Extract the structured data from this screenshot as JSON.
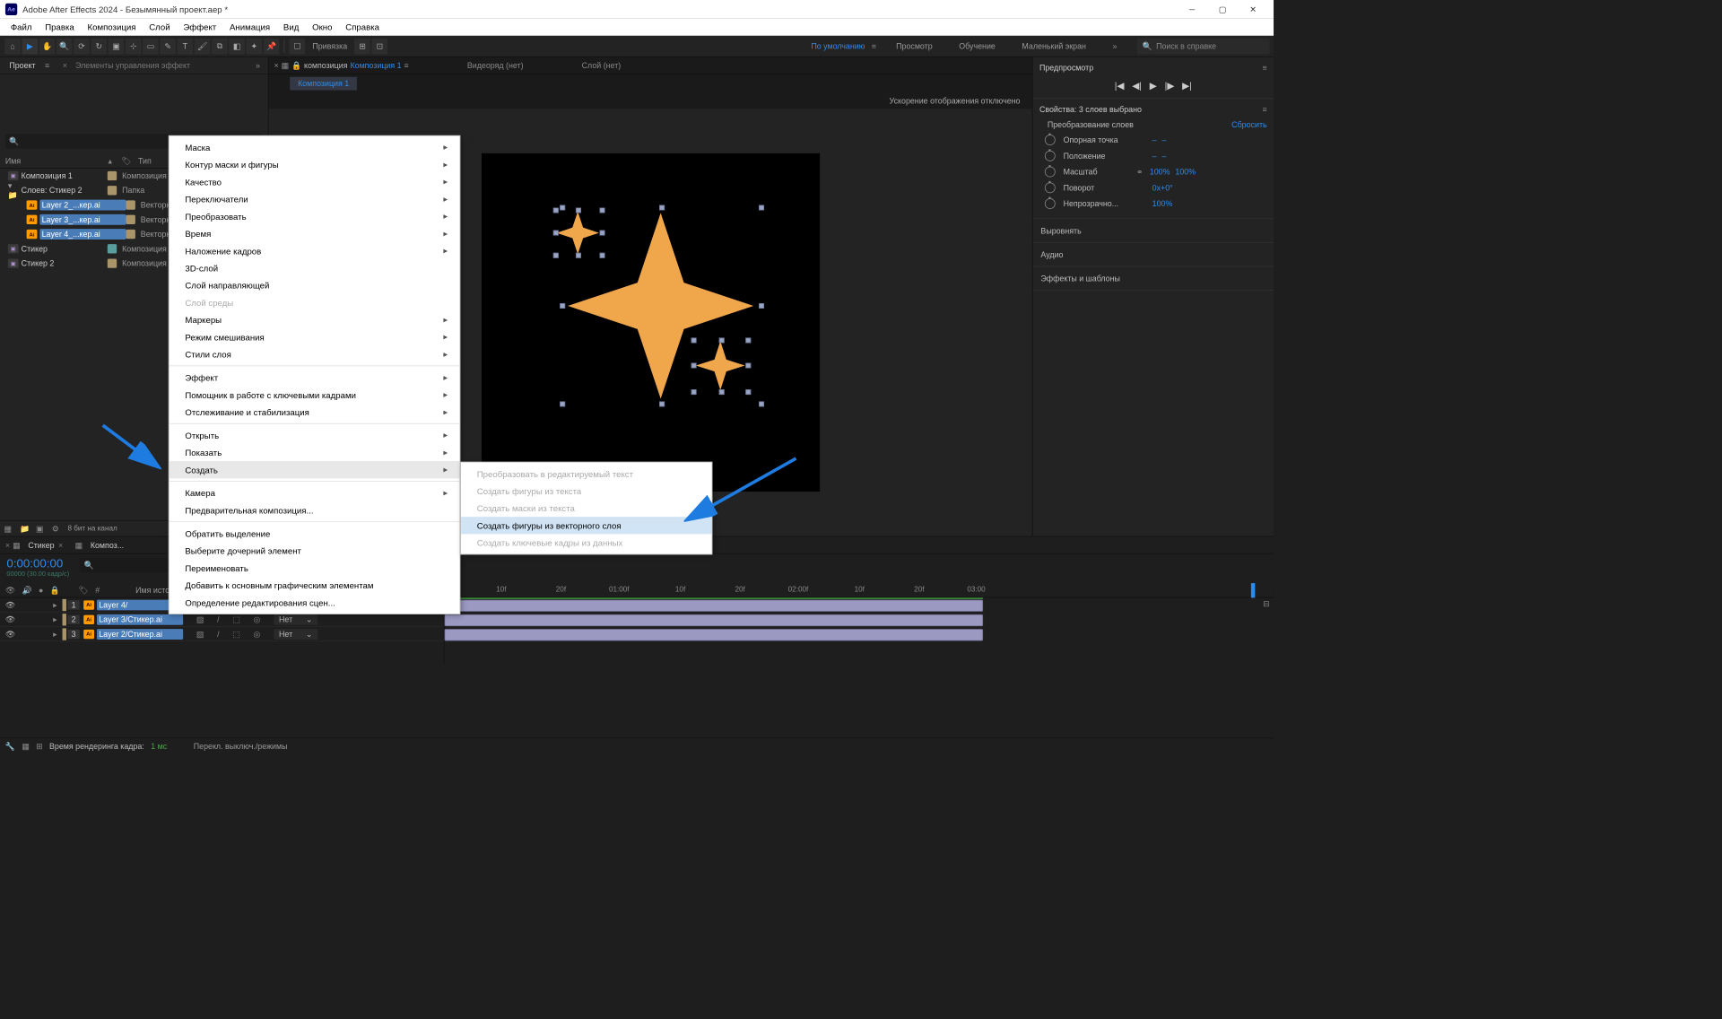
{
  "titlebar": {
    "app_icon": "Ae",
    "title": "Adobe After Effects 2024 - Безымянный проект.aep *"
  },
  "menubar": [
    "Файл",
    "Правка",
    "Композиция",
    "Слой",
    "Эффект",
    "Анимация",
    "Вид",
    "Окно",
    "Справка"
  ],
  "toolbar": {
    "snapping": "Привязка",
    "workspaces": [
      "По умолчанию",
      "Просмотр",
      "Обучение",
      "Маленький экран"
    ],
    "search_placeholder": "Поиск в справке"
  },
  "left_panel": {
    "tabs": {
      "project": "Проект",
      "effect_controls": "Элементы управления эффект"
    },
    "headers": {
      "name": "Имя",
      "type": "Тип"
    },
    "items": [
      {
        "kind": "comp",
        "name": "Композиция 1",
        "type": "Композиция",
        "indent": 0,
        "tag": "gold",
        "selected": false
      },
      {
        "kind": "folder",
        "name": "Слоев: Стикер 2",
        "type": "Папка",
        "indent": 0,
        "tag": "gold",
        "expanded": true,
        "selected": false
      },
      {
        "kind": "ai",
        "name": "Layer 2_...кер.ai",
        "type": "Векторн...",
        "indent": 2,
        "tag": "gold",
        "selected": true
      },
      {
        "kind": "ai",
        "name": "Layer 3_...кер.ai",
        "type": "Векторн...",
        "indent": 2,
        "tag": "gold",
        "selected": true
      },
      {
        "kind": "ai",
        "name": "Layer 4_...кер.ai",
        "type": "Векторн...",
        "indent": 2,
        "tag": "gold",
        "selected": true
      },
      {
        "kind": "comp",
        "name": "Стикер",
        "type": "Композиция",
        "indent": 0,
        "tag": "teal",
        "selected": false
      },
      {
        "kind": "comp",
        "name": "Стикер 2",
        "type": "Композиция",
        "indent": 0,
        "tag": "gold",
        "selected": false
      }
    ],
    "bpc": "8 бит на канал"
  },
  "center": {
    "tabs": {
      "comp_label": "композиция",
      "comp_name": "Композиция 1",
      "video": "Видеоряд  (нет)",
      "layer": "Слой (нет)"
    },
    "active_tab": "Композиция 1",
    "gpu_msg": "Ускорение отображения отключено"
  },
  "right": {
    "preview_title": "Предпросмотр",
    "props_title": "Свойства: 3 слоев выбрано",
    "transform": "Преобразование слоев",
    "reset": "Сбросить",
    "props": [
      {
        "name": "Опорная точка",
        "vals": [
          "–",
          "–"
        ]
      },
      {
        "name": "Положение",
        "vals": [
          "–",
          "–"
        ]
      },
      {
        "name": "Масштаб",
        "vals": [
          "100%",
          "100%"
        ],
        "link": true
      },
      {
        "name": "Поворот",
        "vals": [
          "0x+0°"
        ]
      },
      {
        "name": "Непрозрачно...",
        "vals": [
          "100%"
        ]
      }
    ],
    "panels": [
      "Выровнять",
      "Аудио",
      "Эффекты и шаблоны"
    ]
  },
  "timeline": {
    "tabs": [
      "Стикер",
      "Композ..."
    ],
    "timecode": "0:00:00:00",
    "fps": "00000 (30.00 кадр/с)",
    "source_col": "Имя источни...",
    "layers": [
      {
        "num": "1",
        "name": "Layer 4/",
        "color": "gold",
        "selected": true
      },
      {
        "num": "2",
        "name": "Layer 3/Стикер.ai",
        "color": "gold",
        "selected": true,
        "parent": "Нет"
      },
      {
        "num": "3",
        "name": "Layer 2/Стикер.ai",
        "color": "gold",
        "selected": true,
        "parent": "Нет"
      }
    ],
    "ruler": [
      "10f",
      "20f",
      "01:00f",
      "10f",
      "20f",
      "02:00f",
      "10f",
      "20f",
      "03:00"
    ],
    "footer": {
      "render_label": "Время рендеринга кадра:",
      "render_ms": "1 мс",
      "toggle": "Перекл. выключ./режимы"
    }
  },
  "context_menu": {
    "main": [
      {
        "label": "Маска",
        "arrow": true
      },
      {
        "label": "Контур маски и фигуры",
        "arrow": true
      },
      {
        "label": "Качество",
        "arrow": true
      },
      {
        "label": "Переключатели",
        "arrow": true
      },
      {
        "label": "Преобразовать",
        "arrow": true
      },
      {
        "label": "Время",
        "arrow": true
      },
      {
        "label": "Наложение кадров",
        "arrow": true
      },
      {
        "label": "3D-слой"
      },
      {
        "label": "Слой направляющей"
      },
      {
        "label": "Слой среды",
        "disabled": true
      },
      {
        "label": "Маркеры",
        "arrow": true
      },
      {
        "label": "Режим смешивания",
        "arrow": true
      },
      {
        "label": "Стили слоя",
        "arrow": true
      },
      {
        "sep": true
      },
      {
        "label": "Эффект",
        "arrow": true
      },
      {
        "label": "Помощник в работе с ключевыми кадрами",
        "arrow": true
      },
      {
        "label": "Отслеживание и стабилизация",
        "arrow": true
      },
      {
        "sep": true
      },
      {
        "label": "Открыть",
        "arrow": true
      },
      {
        "label": "Показать",
        "arrow": true
      },
      {
        "label": "Создать",
        "arrow": true,
        "hover": true
      },
      {
        "sep": true
      },
      {
        "label": "Камера",
        "arrow": true
      },
      {
        "label": "Предварительная композиция..."
      },
      {
        "sep": true
      },
      {
        "label": "Обратить выделение"
      },
      {
        "label": "Выберите дочерний элемент"
      },
      {
        "label": "Переименовать"
      },
      {
        "label": "Добавить к основным графическим элементам"
      },
      {
        "label": "Определение редактирования сцен..."
      }
    ],
    "sub": [
      {
        "label": "Преобразовать в редактируемый текст",
        "disabled": true
      },
      {
        "label": "Создать фигуры из текста",
        "disabled": true
      },
      {
        "label": "Создать маски из текста",
        "disabled": true
      },
      {
        "label": "Создать фигуры из векторного слоя",
        "highlighted": true
      },
      {
        "label": "Создать ключевые кадры из данных",
        "disabled": true
      }
    ]
  }
}
